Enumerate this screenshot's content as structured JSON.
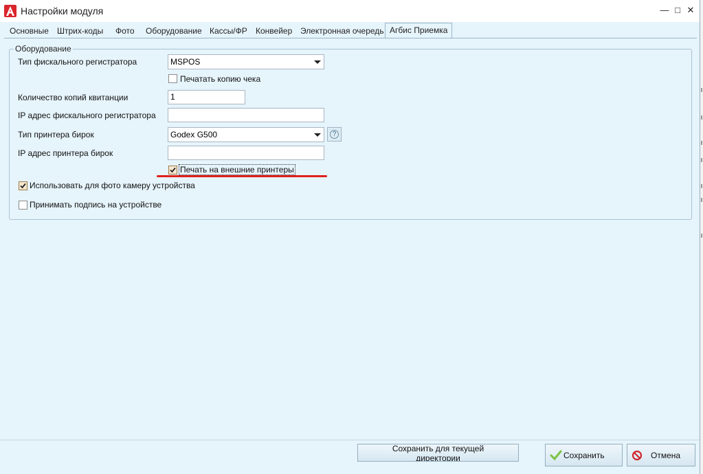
{
  "window": {
    "title": "Настройки модуля",
    "buttons": {
      "minimize": "—",
      "maximize": "□",
      "close": "✕"
    }
  },
  "tabs": [
    "Основные",
    "Штрих-коды",
    "Фото",
    "Оборудование",
    "Кассы/ФР",
    "Конвейер",
    "Электронная очередь",
    "Агбис Приемка"
  ],
  "active_tab": "Агбис Приемка",
  "group": {
    "legend": "Оборудование",
    "fiscal_type": {
      "label": "Тип фискального регистратора",
      "value": "MSPOS"
    },
    "print_copy": {
      "label": "Печатать копию чека",
      "checked": false
    },
    "copies": {
      "label": "Количество копий квитанции",
      "value": "1"
    },
    "fiscal_ip": {
      "label": "IP адрес фискального регистратора",
      "value": ""
    },
    "printer_type": {
      "label": "Тип принтера бирок",
      "value": "Godex G500"
    },
    "printer_ip": {
      "label": "IP адрес принтера бирок",
      "value": ""
    },
    "external_print": {
      "label": "Печать на внешние принтеры",
      "checked": true
    },
    "device_camera": {
      "label": "Использовать для фото камеру устройства",
      "checked": true
    },
    "device_sign": {
      "label": "Принимать подпись на устройстве",
      "checked": false
    }
  },
  "buttons": {
    "save_current_line1": "Сохранить для текущей",
    "save_current_line2": "директории",
    "save": "Сохранить",
    "cancel": "Отмена"
  },
  "colors": {
    "highlight_line": "#e0201c",
    "background": "#e6f4fb",
    "app_icon": "#d9262c"
  }
}
